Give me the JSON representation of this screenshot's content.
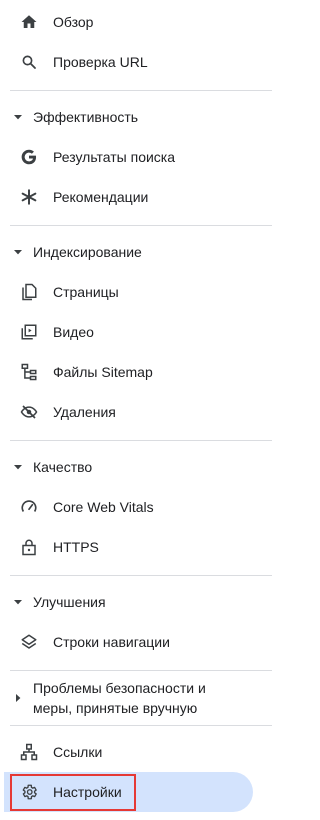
{
  "nav": {
    "overview": "Обзор",
    "url_inspection": "Проверка URL",
    "performance": {
      "title": "Эффективность",
      "search_results": "Результаты поиска",
      "discover": "Рекомендации"
    },
    "indexing": {
      "title": "Индексирование",
      "pages": "Страницы",
      "video": "Видео",
      "sitemaps": "Файлы Sitemap",
      "removals": "Удаления"
    },
    "experience": {
      "title": "Качество",
      "core_web_vitals": "Core Web Vitals",
      "https": "HTTPS"
    },
    "enhancements": {
      "title": "Улучшения",
      "breadcrumbs": "Строки навигации"
    },
    "security": {
      "title": "Проблемы безопасности и меры, принятые вручную"
    },
    "links": "Ссылки",
    "settings": "Настройки"
  },
  "colors": {
    "active_bg": "#d3e3fd",
    "highlight_border": "#e53935",
    "icon": "#3c4043",
    "divider": "#dadce0"
  }
}
